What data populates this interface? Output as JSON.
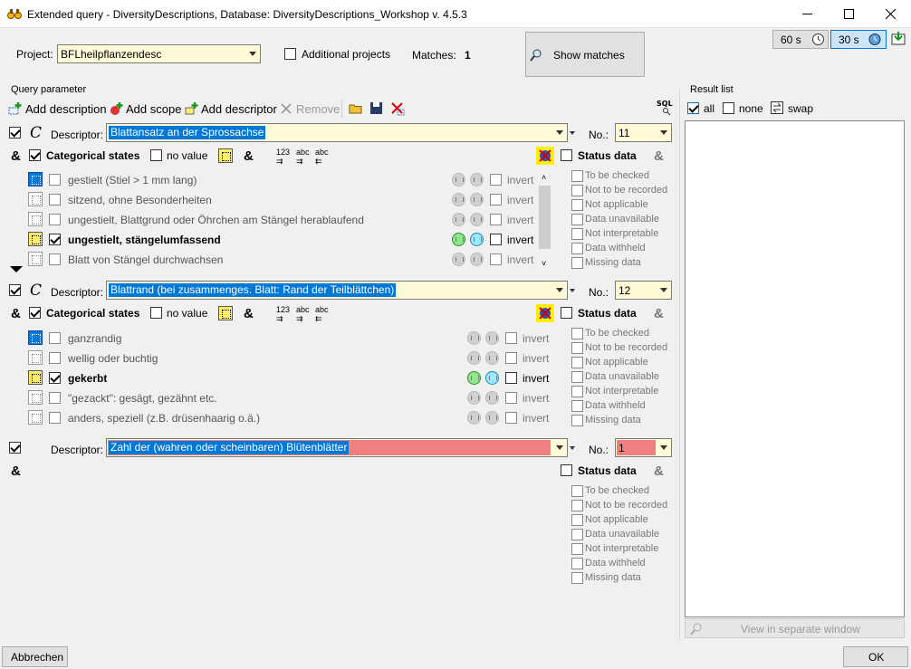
{
  "window": {
    "title": "Extended query - DiversityDescriptions,  Database: DiversityDescriptions_Workshop    v. 4.5.3",
    "app_icon": "binoculars-icon"
  },
  "header": {
    "project_label": "Project:",
    "project_value": "BFLheilpflanzendesc",
    "additional_projects_label": "Additional projects",
    "additional_projects_checked": false,
    "matches_label": "Matches:",
    "matches_value": "1",
    "show_matches_label": "Show matches",
    "timer1": "60 s",
    "timer2": "30 s"
  },
  "query": {
    "group_label": "Query parameter",
    "toolbar": {
      "add_description": "Add description",
      "add_scope": "Add scope",
      "add_descriptor": "Add descriptor",
      "remove": "Remove"
    },
    "descriptor_label": "Descriptor:",
    "no_label": "No.:",
    "categorical_label": "Categorical states",
    "no_value_label": "no value",
    "status_label": "Status data",
    "invert_label": "invert",
    "status_items": [
      "To be checked",
      "Not to be recorded",
      "Not applicable",
      "Data unavailable",
      "Not interpretable",
      "Data withheld",
      "Missing data"
    ],
    "blocks": [
      {
        "descriptor": "Blattansatz an der Sprossachse",
        "no": "11",
        "states": [
          {
            "label": "gestielt (Stiel > 1 mm lang)",
            "checked": false,
            "active": false,
            "invert_on": false
          },
          {
            "label": "sitzend, ohne Besonderheiten",
            "checked": false,
            "active": false,
            "invert_on": false
          },
          {
            "label": "ungestielt, Blattgrund oder Öhrchen am Stängel herablaufend",
            "checked": false,
            "active": false,
            "invert_on": false
          },
          {
            "label": "ungestielt, stängelumfassend",
            "checked": true,
            "active": true,
            "invert_on": true
          },
          {
            "label": "Blatt von Stängel durchwachsen",
            "checked": false,
            "active": false,
            "invert_on": false
          }
        ]
      },
      {
        "descriptor": "Blattrand (bei zusammenges. Blatt: Rand der Teilblättchen)",
        "no": "12",
        "states": [
          {
            "label": "ganzrandig",
            "checked": false,
            "active": false,
            "invert_on": false
          },
          {
            "label": "wellig oder buchtig",
            "checked": false,
            "active": false,
            "invert_on": false
          },
          {
            "label": "gekerbt",
            "checked": true,
            "active": true,
            "invert_on": true
          },
          {
            "label": "\"gezackt\": gesägt, gezähnt etc.",
            "checked": false,
            "active": false,
            "invert_on": false
          },
          {
            "label": "anders, speziell (z.B. drüsenhaarig o.ä.)",
            "checked": false,
            "active": false,
            "invert_on": false
          }
        ]
      },
      {
        "descriptor": "Zahl der (wahren oder scheinbaren) Blütenblätter",
        "no": "1"
      }
    ]
  },
  "result": {
    "group_label": "Result list",
    "all_label": "all",
    "none_label": "none",
    "swap_label": "swap",
    "view_separate": "View in separate window"
  },
  "footer": {
    "cancel": "Abbrechen",
    "ok": "OK"
  }
}
